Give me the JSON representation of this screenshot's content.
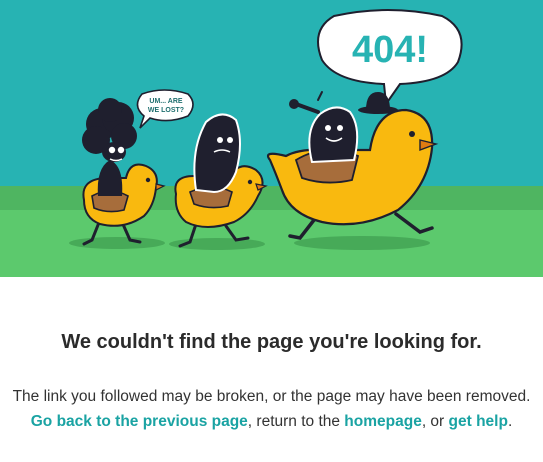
{
  "illustration": {
    "bubble_main": "404!",
    "bubble_small_line1": "UM... ARE",
    "bubble_small_line2": "WE LOST?",
    "colors": {
      "sky": "#27b3b3",
      "grass_light": "#52b860",
      "grass": "#5cc96d",
      "duck": "#f9b90f",
      "outline": "#1f1f2e",
      "saddle": "#a76d3b"
    }
  },
  "page": {
    "title": "We couldn't find the page you're looking for.",
    "message_line1": "The link you followed may be broken, or the page may have been removed.",
    "link_back": "Go back to the previous page",
    "text_return": ", return to the ",
    "link_home": "homepage",
    "text_or": ", or ",
    "link_help": "get help",
    "text_end": "."
  }
}
